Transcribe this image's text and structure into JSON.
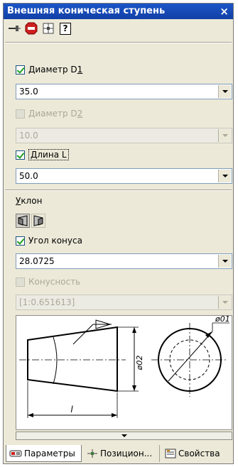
{
  "window": {
    "title": "Внешняя коническая ступень",
    "close": "×"
  },
  "toolbar": {
    "help_label": "?"
  },
  "diameter_d1": {
    "label_prefix": "Диаметр D",
    "label_suffix": "1",
    "checked": true,
    "value": "35.0"
  },
  "diameter_d2": {
    "label_prefix": "Диаметр D",
    "label_suffix": "2",
    "checked": false,
    "value": "10.0"
  },
  "length_l": {
    "label": "Длина L",
    "checked": true,
    "value": "50.0"
  },
  "slope": {
    "label_u": "У",
    "label_rest": "клон"
  },
  "cone_angle": {
    "label": "Угол конуса",
    "checked": true,
    "value": "28.0725"
  },
  "taper": {
    "label": "Конусность",
    "checked": false,
    "value": "[1:0.651613]"
  },
  "drawing": {
    "dim_d2": "ø02",
    "dim_d1": "ø01",
    "dim_l": "l"
  },
  "tabs": [
    {
      "label": "Параметры"
    },
    {
      "label": "Позицион..."
    },
    {
      "label": "Свойства"
    }
  ]
}
